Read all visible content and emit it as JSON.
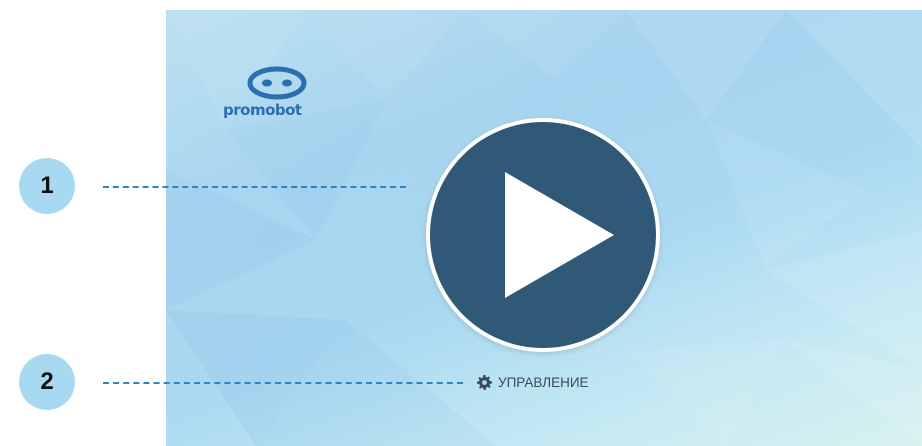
{
  "logo": {
    "text": "promobot",
    "icon": "robot-face-icon",
    "color": "#2a6fb0"
  },
  "player": {
    "icon": "play-icon",
    "button_color": "#2f5977"
  },
  "controls": {
    "label": "УПРАВЛЕНИЕ",
    "icon": "gear-icon"
  },
  "callouts": [
    {
      "number": "1"
    },
    {
      "number": "2"
    }
  ],
  "colors": {
    "callout_bg": "#a7daf2",
    "dash": "#2d86c4"
  }
}
